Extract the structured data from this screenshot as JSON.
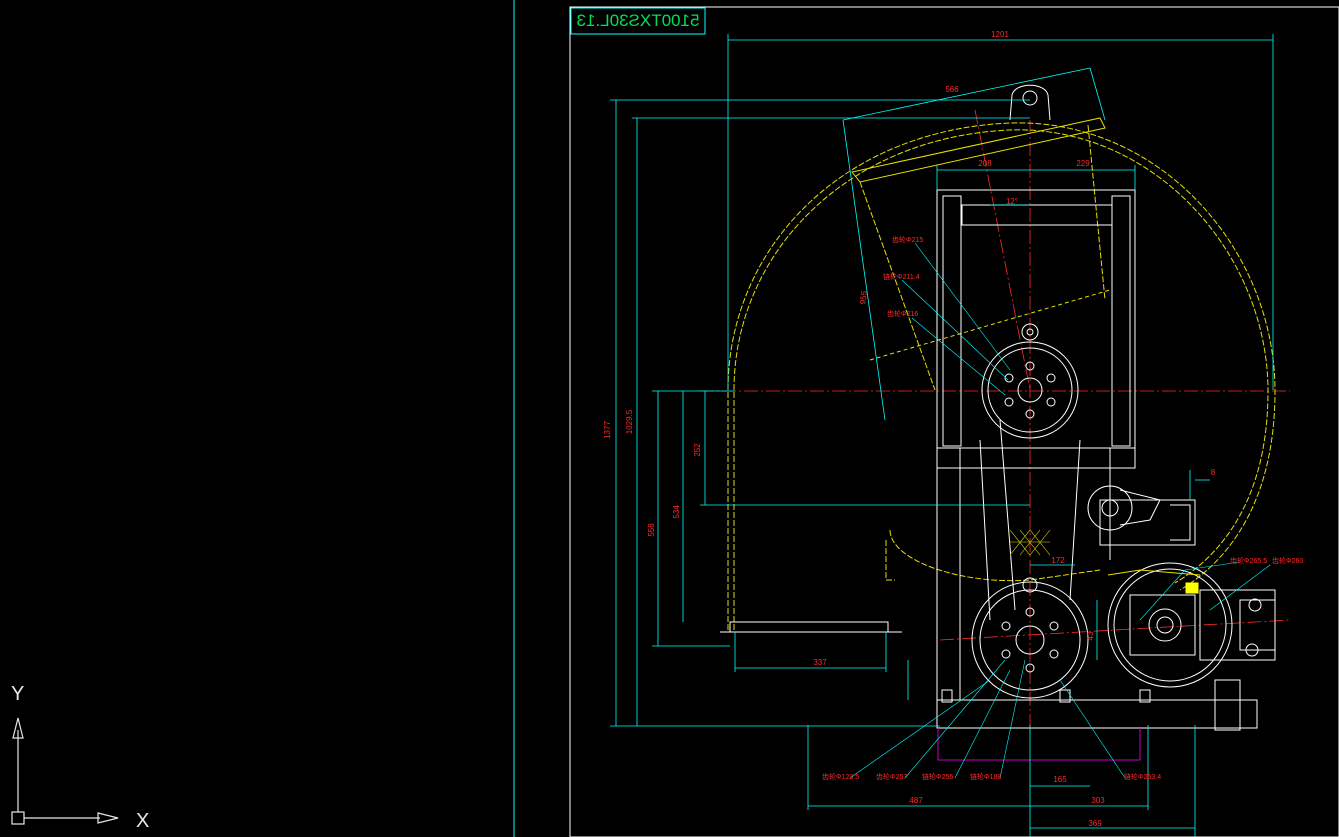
{
  "app": {
    "view": "CAD model space (mirrored drawing)"
  },
  "title_block": {
    "text": "5100TXS30L.13",
    "color": "#00e05a"
  },
  "colors": {
    "background": "#000000",
    "frame": "#00ffff",
    "dimension": "#ff2a2a",
    "hidden": "#e8e000",
    "body": "#ffffff",
    "centerline": "#ff2a2a",
    "highlight": "#ffff00",
    "purple": "#c000c0"
  },
  "ucs": {
    "x_label": "X",
    "y_label": "Y",
    "icon": "ucs-axis-icon"
  },
  "dimensions": {
    "overall_width": "1201",
    "arm_width": "566",
    "top_left": "208",
    "top_right": "229",
    "angle": "12°",
    "arm_length": "955",
    "total_height": "1377",
    "height_b": "1029.5",
    "mid_height": "558",
    "mid_height_b": "534",
    "small_height": "252",
    "base_offset": "337",
    "gap_8": "8",
    "span_172": "172",
    "span_43": "43",
    "bottom_487": "487",
    "bottom_165": "165",
    "bottom_303": "303",
    "bottom_369": "369"
  },
  "labels": {
    "d215": "齿轮Φ215",
    "d211": "链轮Φ211.4",
    "d216": "齿轮Φ216",
    "d265": "齿轮Φ265.5",
    "d260": "齿轮Φ260",
    "d123": "齿轮Φ123.5",
    "d257": "齿轮Φ257",
    "d256": "链轮Φ256",
    "d188": "链轮Φ188",
    "d253": "链轮Φ253.4"
  }
}
